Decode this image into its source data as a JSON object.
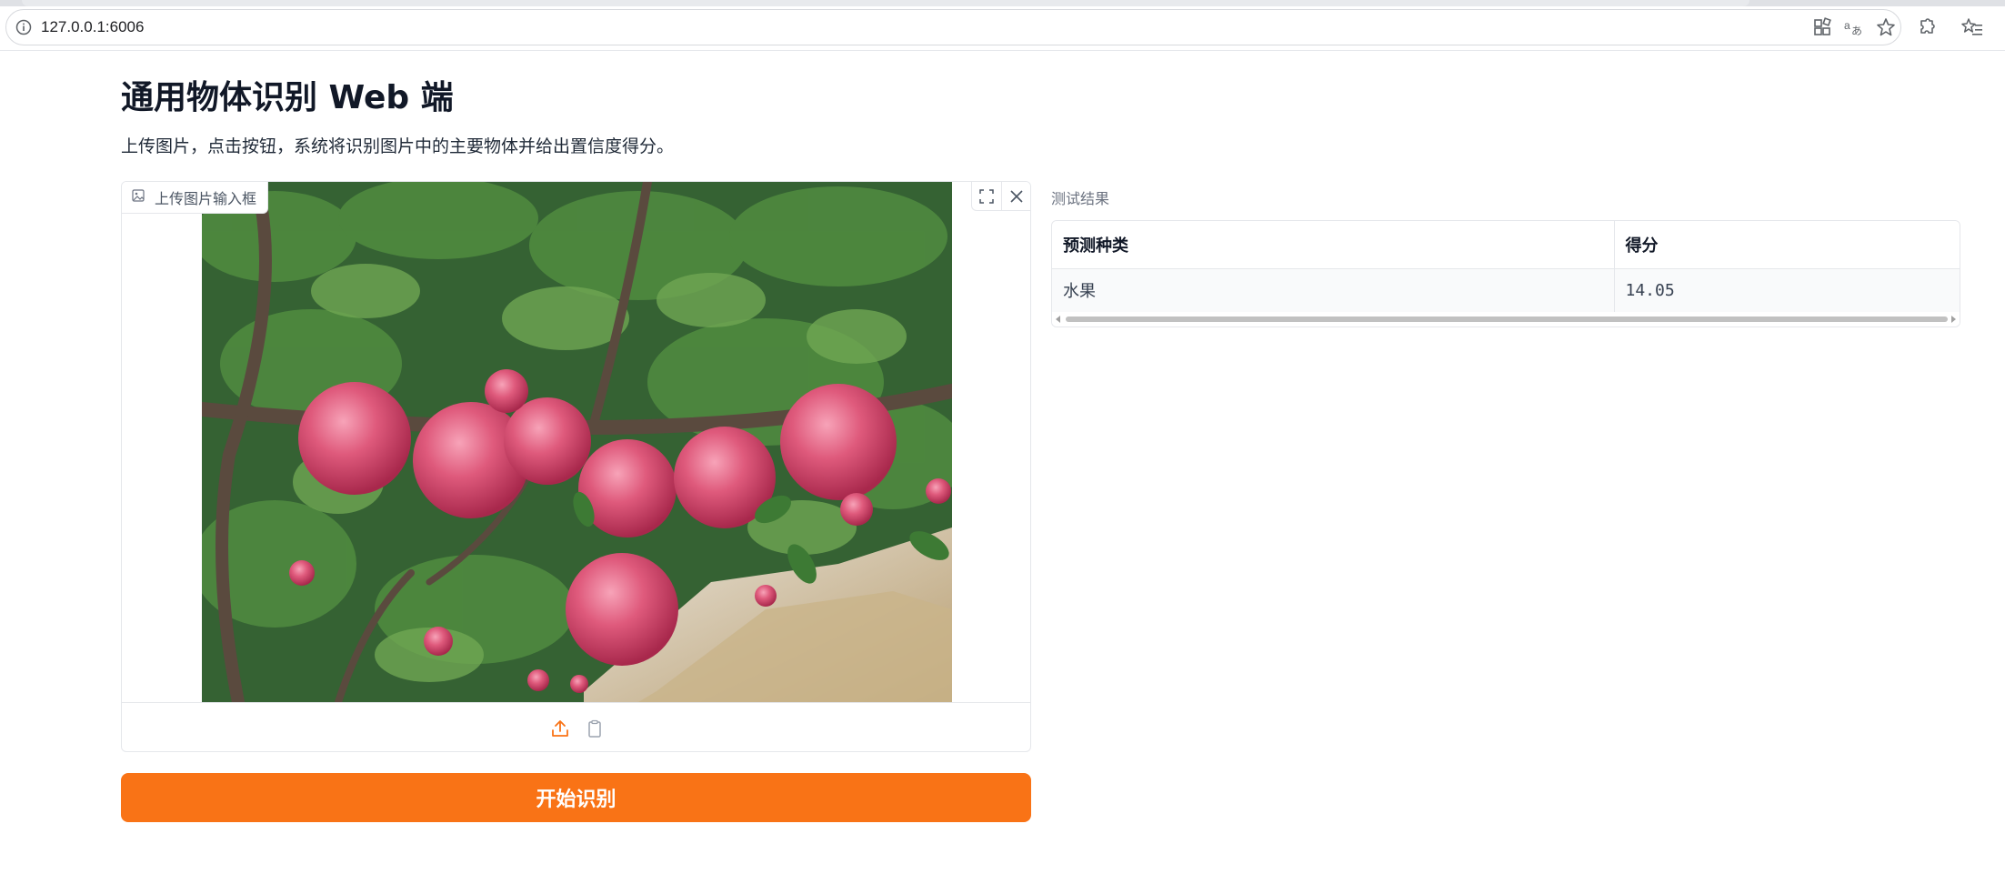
{
  "browser": {
    "url": "127.0.0.1:6006",
    "icons": [
      "info-icon",
      "apps-icon",
      "translate-icon",
      "star-icon",
      "extensions-icon",
      "favorites-icon"
    ]
  },
  "page": {
    "title": "通用物体识别 Web 端",
    "description": "上传图片，点击按钮，系统将识别图片中的主要物体并给出置信度得分。"
  },
  "image_input": {
    "label": "上传图片输入框",
    "image_alt": "apple tree with red apples",
    "toolbar": [
      "upload-icon",
      "clipboard-icon"
    ],
    "controls": [
      "fullscreen-icon",
      "close-icon"
    ]
  },
  "run_button": {
    "label": "开始识别"
  },
  "result": {
    "label": "测试结果",
    "headers": [
      "预测种类",
      "得分"
    ],
    "rows": [
      [
        "水果",
        "14.05"
      ]
    ]
  },
  "colors": {
    "accent": "#f97316",
    "upload_icon": "#f97316"
  }
}
